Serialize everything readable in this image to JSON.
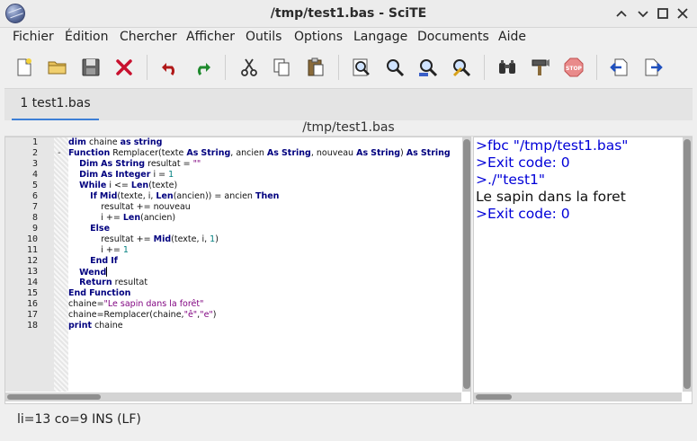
{
  "window": {
    "title": "/tmp/test1.bas - SciTE",
    "controls": [
      "chevron-up-icon",
      "chevron-down-icon",
      "maximize-icon",
      "close-icon"
    ]
  },
  "menu": [
    "Fichier",
    "Édition",
    "Chercher",
    "Afficher",
    "Outils",
    "Options",
    "Langage",
    "Documents",
    "Aide"
  ],
  "toolbar": [
    "new-file-icon",
    "open-folder-icon",
    "save-icon",
    "close-file-icon",
    "undo-icon",
    "redo-icon",
    "cut-icon",
    "copy-icon",
    "paste-icon",
    "zoom-page-icon",
    "find-icon",
    "find-next-icon",
    "replace-icon",
    "binoculars-icon",
    "build-icon",
    "stop-icon",
    "previous-buffer-icon",
    "next-buffer-icon"
  ],
  "tab": {
    "label": "1 test1.bas"
  },
  "path": "/tmp/test1.bas",
  "editor": {
    "line_numbers": [
      "1",
      "2",
      "3",
      "4",
      "5",
      "6",
      "7",
      "8",
      "9",
      "10",
      "11",
      "12",
      "13",
      "14",
      "15",
      "16",
      "17",
      "18"
    ],
    "fold_marker": "-",
    "caret_line": 13,
    "lines": [
      [
        {
          "t": "dim",
          "c": "kw"
        },
        {
          "t": " chaine "
        },
        {
          "t": "as",
          "c": "kw"
        },
        {
          "t": " "
        },
        {
          "t": "string",
          "c": "kw"
        }
      ],
      [
        {
          "t": "Function",
          "c": "kw"
        },
        {
          "t": " Remplacer(texte "
        },
        {
          "t": "As",
          "c": "kw"
        },
        {
          "t": " "
        },
        {
          "t": "String",
          "c": "kw"
        },
        {
          "t": ", ancien "
        },
        {
          "t": "As",
          "c": "kw"
        },
        {
          "t": " "
        },
        {
          "t": "String",
          "c": "kw"
        },
        {
          "t": ", nouveau "
        },
        {
          "t": "As",
          "c": "kw"
        },
        {
          "t": " "
        },
        {
          "t": "String",
          "c": "kw"
        },
        {
          "t": ") "
        },
        {
          "t": "As",
          "c": "kw"
        },
        {
          "t": " "
        },
        {
          "t": "String",
          "c": "kw"
        }
      ],
      [
        {
          "t": "    "
        },
        {
          "t": "Dim",
          "c": "kw"
        },
        {
          "t": " "
        },
        {
          "t": "As",
          "c": "kw"
        },
        {
          "t": " "
        },
        {
          "t": "String",
          "c": "kw"
        },
        {
          "t": " resultat = "
        },
        {
          "t": "\"\"",
          "c": "str"
        }
      ],
      [
        {
          "t": "    "
        },
        {
          "t": "Dim",
          "c": "kw"
        },
        {
          "t": " "
        },
        {
          "t": "As",
          "c": "kw"
        },
        {
          "t": " "
        },
        {
          "t": "Integer",
          "c": "kw"
        },
        {
          "t": " i = "
        },
        {
          "t": "1",
          "c": "num"
        }
      ],
      [
        {
          "t": "    "
        },
        {
          "t": "While",
          "c": "kw"
        },
        {
          "t": " i <= "
        },
        {
          "t": "Len",
          "c": "kw"
        },
        {
          "t": "(texte)"
        }
      ],
      [
        {
          "t": "        "
        },
        {
          "t": "If",
          "c": "kw"
        },
        {
          "t": " "
        },
        {
          "t": "Mid",
          "c": "kw"
        },
        {
          "t": "(texte, i, "
        },
        {
          "t": "Len",
          "c": "kw"
        },
        {
          "t": "(ancien)) = ancien "
        },
        {
          "t": "Then",
          "c": "kw"
        }
      ],
      [
        {
          "t": "            resultat += nouveau"
        }
      ],
      [
        {
          "t": "            i += "
        },
        {
          "t": "Len",
          "c": "kw"
        },
        {
          "t": "(ancien)"
        }
      ],
      [
        {
          "t": "        "
        },
        {
          "t": "Else",
          "c": "kw"
        }
      ],
      [
        {
          "t": "            resultat += "
        },
        {
          "t": "Mid",
          "c": "kw"
        },
        {
          "t": "(texte, i, "
        },
        {
          "t": "1",
          "c": "num"
        },
        {
          "t": ")"
        }
      ],
      [
        {
          "t": "            i += "
        },
        {
          "t": "1",
          "c": "num"
        }
      ],
      [
        {
          "t": "        "
        },
        {
          "t": "End",
          "c": "kw"
        },
        {
          "t": " "
        },
        {
          "t": "If",
          "c": "kw"
        }
      ],
      [
        {
          "t": "    "
        },
        {
          "t": "Wend",
          "c": "kw"
        }
      ],
      [
        {
          "t": "    "
        },
        {
          "t": "Return",
          "c": "kw"
        },
        {
          "t": " resultat"
        }
      ],
      [
        {
          "t": "End",
          "c": "kw"
        },
        {
          "t": " "
        },
        {
          "t": "Function",
          "c": "kw"
        }
      ],
      [
        {
          "t": "chaine="
        },
        {
          "t": "\"Le sapin dans la forêt\"",
          "c": "str"
        }
      ],
      [
        {
          "t": "chaine=Remplacer(chaine,"
        },
        {
          "t": "\"ê\"",
          "c": "str"
        },
        {
          "t": ","
        },
        {
          "t": "\"e\"",
          "c": "str"
        },
        {
          "t": ")"
        }
      ],
      [
        {
          "t": "print",
          "c": "kw"
        },
        {
          "t": " chaine"
        }
      ]
    ]
  },
  "output": {
    "lines": [
      {
        "text": ">fbc \"/tmp/test1.bas\"",
        "kind": "cmd"
      },
      {
        "text": ">Exit code: 0",
        "kind": "cmd"
      },
      {
        "text": ">./\"test1\"",
        "kind": "cmd"
      },
      {
        "text": "Le sapin dans la foret",
        "kind": "plain"
      },
      {
        "text": ">Exit code: 0",
        "kind": "cmd"
      }
    ]
  },
  "status": "li=13 co=9 INS (LF)",
  "colors": {
    "keyword": "#00007f",
    "string": "#7f007f",
    "number": "#007f7f",
    "output_command": "#0000d8",
    "tab_accent": "#3d7fd6"
  }
}
